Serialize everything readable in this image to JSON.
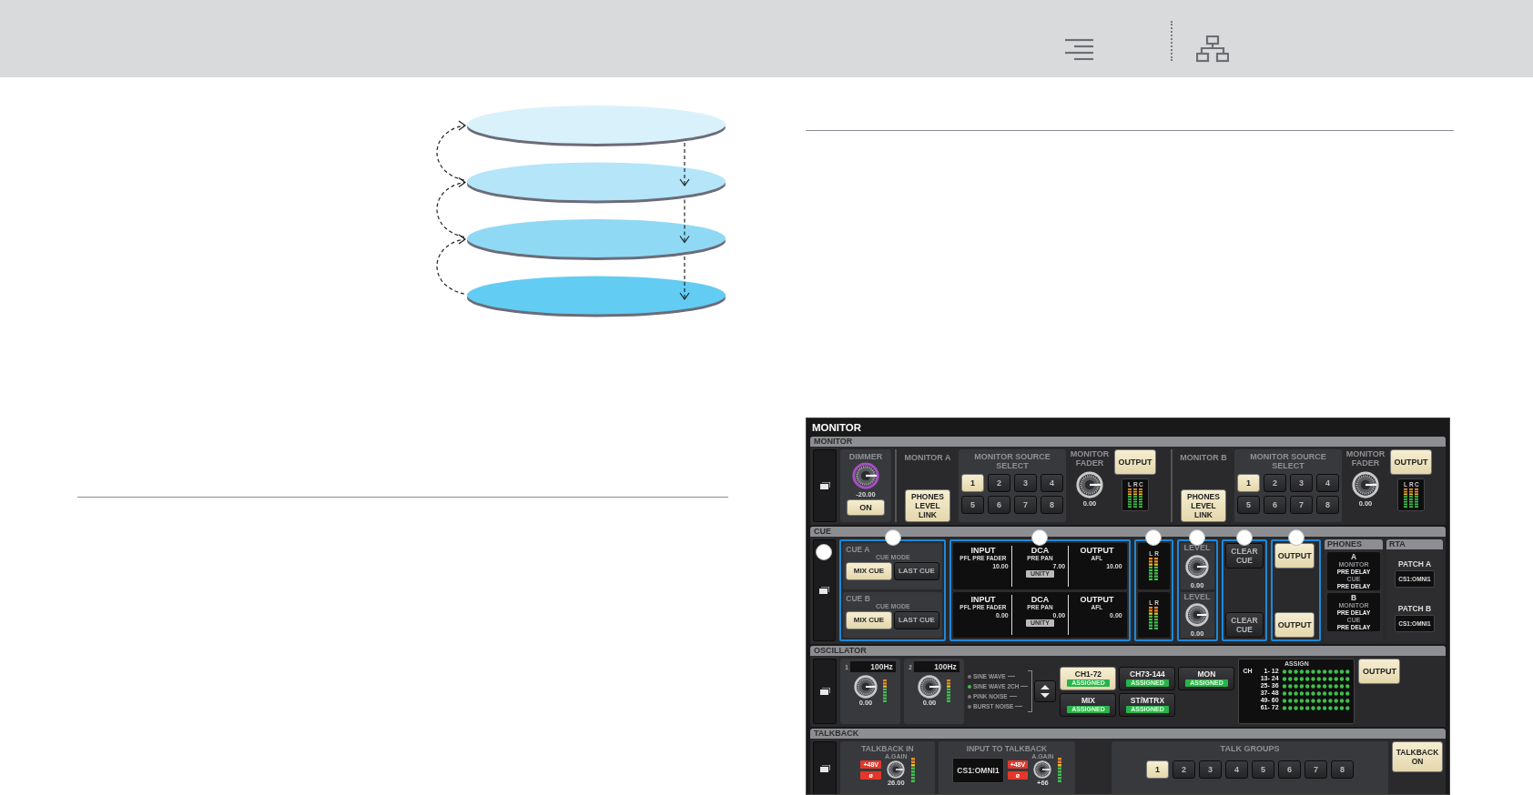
{
  "diagram": {
    "layers": [
      {
        "color": "#d9f1fb"
      },
      {
        "color": "#b4e5f8"
      },
      {
        "color": "#8fd9f5"
      },
      {
        "color": "#62ccf3"
      }
    ]
  },
  "monitor": {
    "title": "MONITOR",
    "monitor_section": {
      "label": "MONITOR",
      "dimmer": {
        "label": "DIMMER",
        "value": "-20.00",
        "on_button": {
          "label": "ON",
          "on": true
        }
      },
      "outputs": [
        {
          "name": "MONITOR A",
          "phones_link": {
            "label": "PHONES LEVEL LINK",
            "on": true
          },
          "source_label": "MONITOR SOURCE SELECT",
          "sources": [
            {
              "label": "1",
              "selected": true
            },
            {
              "label": "2",
              "selected": false
            },
            {
              "label": "3",
              "selected": false
            },
            {
              "label": "4",
              "selected": false
            },
            {
              "label": "5",
              "selected": false
            },
            {
              "label": "6",
              "selected": false
            },
            {
              "label": "7",
              "selected": false
            },
            {
              "label": "8",
              "selected": false
            }
          ],
          "fader_label": "MONITOR FADER",
          "fader_value": "0.00",
          "output": {
            "label": "OUTPUT",
            "on": true
          },
          "meter_channels": [
            "L",
            "R",
            "C"
          ]
        },
        {
          "name": "MONITOR B",
          "phones_link": {
            "label": "PHONES LEVEL LINK",
            "on": true
          },
          "source_label": "MONITOR SOURCE SELECT",
          "sources": [
            {
              "label": "1",
              "selected": true
            },
            {
              "label": "2",
              "selected": false
            },
            {
              "label": "3",
              "selected": false
            },
            {
              "label": "4",
              "selected": false
            },
            {
              "label": "5",
              "selected": false
            },
            {
              "label": "6",
              "selected": false
            },
            {
              "label": "7",
              "selected": false
            },
            {
              "label": "8",
              "selected": false
            }
          ],
          "fader_label": "MONITOR FADER",
          "fader_value": "0.00",
          "output": {
            "label": "OUTPUT",
            "on": true
          },
          "meter_channels": [
            "L",
            "R",
            "C"
          ]
        }
      ]
    },
    "cue_section": {
      "label": "CUE",
      "cues": [
        {
          "name": "CUE A",
          "mode_label": "CUE MODE",
          "modes": [
            {
              "label": "MIX CUE",
              "selected": true
            },
            {
              "label": "LAST CUE",
              "selected": false
            }
          ],
          "points": [
            {
              "label": "INPUT",
              "mode": "PFL PRE FADER",
              "value": "10.00"
            },
            {
              "label": "DCA",
              "mode": "PRE PAN",
              "value": "7.00"
            },
            {
              "label": "OUTPUT",
              "mode": "AFL",
              "value": "10.00"
            }
          ],
          "unity": "UNITY",
          "meter_channels": [
            "L",
            "R"
          ],
          "level_label": "LEVEL",
          "level_value": "0.00",
          "clear": "CLEAR CUE",
          "output": {
            "label": "OUTPUT",
            "on": true
          }
        },
        {
          "name": "CUE B",
          "mode_label": "CUE MODE",
          "modes": [
            {
              "label": "MIX CUE",
              "selected": true
            },
            {
              "label": "LAST CUE",
              "selected": false
            }
          ],
          "points": [
            {
              "label": "INPUT",
              "mode": "PFL PRE FADER",
              "value": "0.00"
            },
            {
              "label": "DCA",
              "mode": "PRE PAN",
              "value": "0.00"
            },
            {
              "label": "OUTPUT",
              "mode": "AFL",
              "value": "0.00"
            }
          ],
          "unity": "UNITY",
          "meter_channels": [
            "L",
            "R"
          ],
          "level_label": "LEVEL",
          "level_value": "0.00",
          "clear": "CLEAR CUE",
          "output": {
            "label": "OUTPUT",
            "on": true
          }
        }
      ],
      "phones": {
        "label": "PHONES",
        "outputs": [
          {
            "name": "A",
            "rows": [
              {
                "label": "MONITOR",
                "value": "PRE DELAY"
              },
              {
                "label": "CUE",
                "value": "PRE DELAY"
              }
            ]
          },
          {
            "name": "B",
            "rows": [
              {
                "label": "MONITOR",
                "value": "PRE DELAY"
              },
              {
                "label": "CUE",
                "value": "PRE DELAY"
              }
            ]
          }
        ]
      },
      "rta": {
        "label": "RTA",
        "patches": [
          {
            "name": "PATCH A",
            "value": "CS1:OMNI1"
          },
          {
            "name": "PATCH B",
            "value": "CS1:OMNI1"
          }
        ]
      }
    },
    "oscillator_section": {
      "label": "OSCILLATOR",
      "channels": [
        {
          "index": "1",
          "frequency": "100Hz",
          "value": "0.00"
        },
        {
          "index": "2",
          "frequency": "100Hz",
          "value": "0.00"
        }
      ],
      "waveforms": [
        {
          "label": "SINE WAVE",
          "selected": false
        },
        {
          "label": "SINE WAVE 2CH",
          "selected": true
        },
        {
          "label": "PINK NOISE",
          "selected": false
        },
        {
          "label": "BURST NOISE",
          "selected": false
        }
      ],
      "assign_buttons": [
        {
          "label": "CH1-72",
          "status": "ASSIGNED",
          "selected": true
        },
        {
          "label": "CH73-144",
          "status": "ASSIGNED",
          "selected": false
        },
        {
          "label": "MON",
          "status": "ASSIGNED",
          "selected": false
        },
        {
          "label": "MIX",
          "status": "ASSIGNED",
          "selected": false
        },
        {
          "label": "ST/MTRX",
          "status": "ASSIGNED",
          "selected": false
        }
      ],
      "assign_grid": {
        "title": "ASSIGN",
        "ch_label": "CH",
        "rows": [
          "1- 12",
          "13- 24",
          "25- 36",
          "37- 48",
          "49- 60",
          "61- 72"
        ]
      },
      "output": {
        "label": "OUTPUT",
        "on": true
      }
    },
    "talkback_section": {
      "label": "TALKBACK",
      "talkback_in": {
        "label": "TALKBACK IN",
        "gain_label": "A.GAIN",
        "phantom": "+48V",
        "phase": "ø",
        "value": "26.00"
      },
      "input_to_talkback": {
        "label": "INPUT TO TALKBACK",
        "patch": "CS1:OMNI1",
        "gain_label": "A.GAIN",
        "phantom": "+48V",
        "phase": "ø",
        "value": "+66"
      },
      "talk_groups": {
        "label": "TALK GROUPS",
        "groups": [
          {
            "label": "1",
            "selected": true
          },
          {
            "label": "2",
            "selected": false
          },
          {
            "label": "3",
            "selected": false
          },
          {
            "label": "4",
            "selected": false
          },
          {
            "label": "5",
            "selected": false
          },
          {
            "label": "6",
            "selected": false
          },
          {
            "label": "7",
            "selected": false
          },
          {
            "label": "8",
            "selected": false
          }
        ]
      },
      "talkback_on": {
        "label": "TALKBACK ON",
        "on": true
      }
    }
  }
}
